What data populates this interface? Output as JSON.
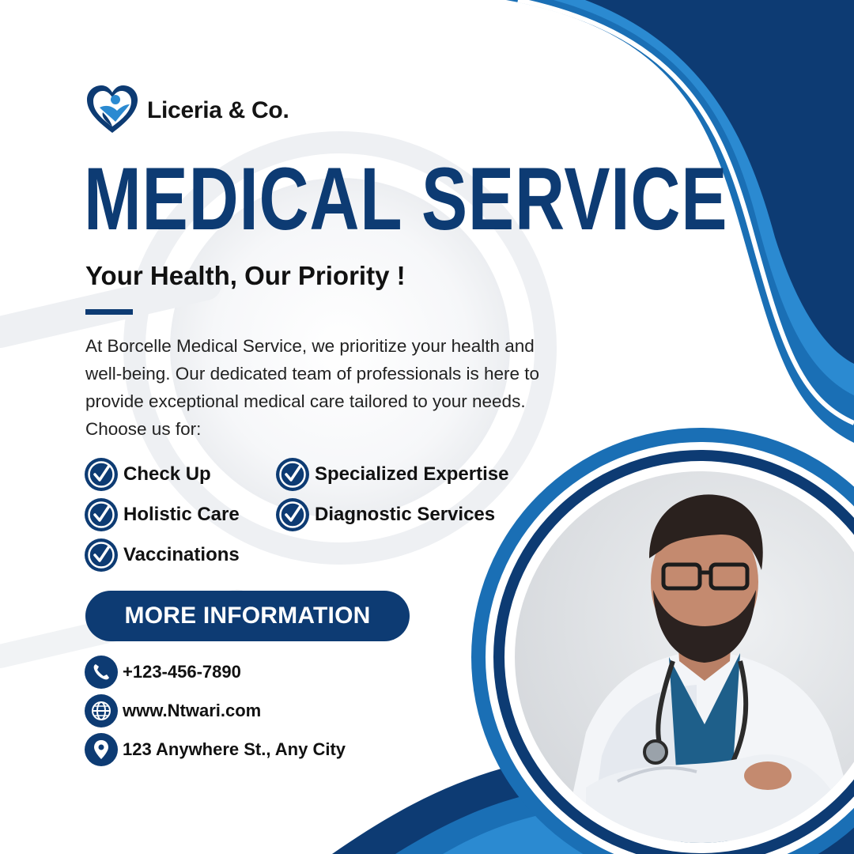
{
  "brand": {
    "name": "Liceria & Co.",
    "logo_icon": "heart-person-logo"
  },
  "headline": "MEDICAL SERVICE",
  "tagline": "Your Health, Our Priority !",
  "description": "At Borcelle Medical Service, we prioritize your health and well-being. Our dedicated team of professionals is here to provide exceptional medical care tailored to your needs. Choose us for:",
  "services": [
    {
      "label": "Check Up",
      "icon": "check-circle-icon"
    },
    {
      "label": "Specialized Expertise",
      "icon": "check-circle-icon"
    },
    {
      "label": "Holistic Care",
      "icon": "check-circle-icon"
    },
    {
      "label": "Diagnostic Services",
      "icon": "check-circle-icon"
    },
    {
      "label": "Vaccinations",
      "icon": "check-circle-icon"
    }
  ],
  "cta": {
    "label": "MORE INFORMATION"
  },
  "contact": {
    "phone": "+123-456-7890",
    "website": "www.Ntwari.com",
    "address": "123 Anywhere St., Any City"
  },
  "colors": {
    "navy": "#0d3b73",
    "blue": "#1a6fb5",
    "light_blue": "#2b8ad1",
    "white": "#ffffff"
  }
}
